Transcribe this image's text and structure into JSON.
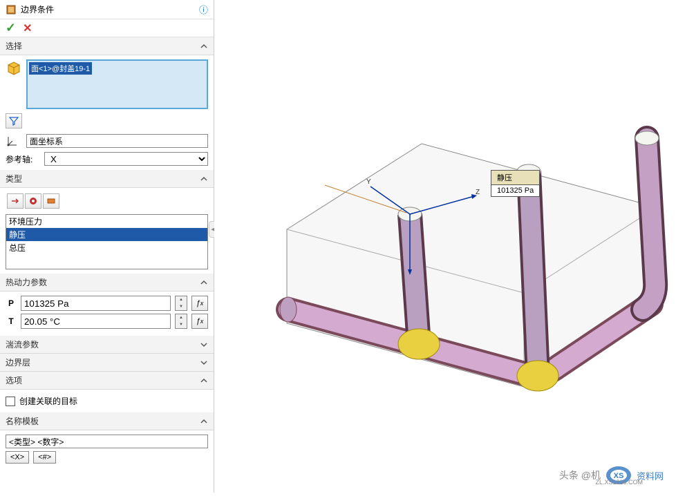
{
  "panel": {
    "title": "边界条件",
    "selection": {
      "header": "选择",
      "item": "面<1>@封盖19-1",
      "coord_label": "面坐标系",
      "axis_lbl": "参考轴:",
      "axis_value": "X"
    },
    "type": {
      "header": "类型",
      "options": [
        "环境压力",
        "静压",
        "总压"
      ],
      "selected": "静压"
    },
    "thermo": {
      "header": "热动力参数",
      "p_lbl": "P",
      "p_val": "101325 Pa",
      "t_lbl": "T",
      "t_val": "20.05 °C"
    },
    "turb": {
      "header": "湍流参数"
    },
    "boundary": {
      "header": "边界层"
    },
    "options": {
      "header": "选项",
      "create_goal": "创建关联的目标"
    },
    "template": {
      "header": "名称模板",
      "value": "<类型> <数字>",
      "b1": "<X>",
      "b2": "<#>"
    }
  },
  "callout": {
    "title": "静压",
    "value": "101325 Pa"
  },
  "watermark": {
    "left": "头条 @机",
    "brand": "资料网",
    "sub": "ZL.XS1616.COM"
  }
}
